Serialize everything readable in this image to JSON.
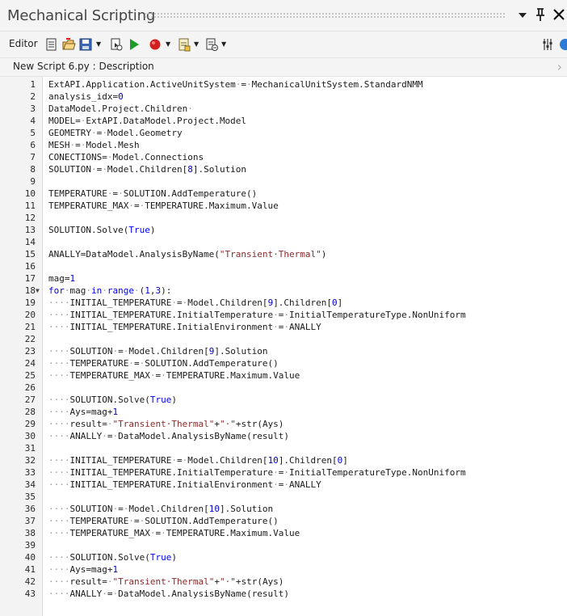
{
  "window": {
    "title": "Mechanical Scripting"
  },
  "toolbar": {
    "editor_label": "Editor"
  },
  "document": {
    "label": "New Script 6.py : Description"
  },
  "colors": {
    "background": "#ffffff",
    "gutter": "#f3f3f3",
    "keyword": "#0000ff",
    "string": "#8b2a2a",
    "run_green": "#1f9b2a",
    "record_red": "#d12020"
  },
  "icons": [
    "dropdown-arrow-icon",
    "pin-icon",
    "close-icon",
    "new-script-icon",
    "open-icon",
    "save-icon",
    "snippets-icon",
    "run-icon",
    "record-icon",
    "insert-icon",
    "breakpoint-icon",
    "settings-icon",
    "help-icon"
  ],
  "code_lines": [
    [
      [
        "t",
        "ExtAPI.Application.ActiveUnitSystem"
      ],
      [
        "w",
        "·"
      ],
      [
        "t",
        "="
      ],
      [
        "w",
        "·"
      ],
      [
        "t",
        "MechanicalUnitSystem.StandardNMM"
      ]
    ],
    [
      [
        "t",
        "analysis_idx="
      ],
      [
        "n",
        "0"
      ]
    ],
    [
      [
        "t",
        "DataModel.Project.Children"
      ],
      [
        "w",
        "·"
      ]
    ],
    [
      [
        "t",
        "MODEL="
      ],
      [
        "w",
        "·"
      ],
      [
        "t",
        "ExtAPI.DataModel.Project.Model"
      ]
    ],
    [
      [
        "t",
        "GEOMETRY"
      ],
      [
        "w",
        "·"
      ],
      [
        "t",
        "="
      ],
      [
        "w",
        "·"
      ],
      [
        "t",
        "Model.Geometry"
      ]
    ],
    [
      [
        "t",
        "MESH"
      ],
      [
        "w",
        "·"
      ],
      [
        "t",
        "="
      ],
      [
        "w",
        "·"
      ],
      [
        "t",
        "Model.Mesh"
      ]
    ],
    [
      [
        "t",
        "CONECTIONS="
      ],
      [
        "w",
        "·"
      ],
      [
        "t",
        "Model.Connections"
      ]
    ],
    [
      [
        "t",
        "SOLUTION"
      ],
      [
        "w",
        "·"
      ],
      [
        "t",
        "="
      ],
      [
        "w",
        "·"
      ],
      [
        "t",
        "Model.Children["
      ],
      [
        "n",
        "8"
      ],
      [
        "t",
        "].Solution"
      ]
    ],
    [],
    [
      [
        "t",
        "TEMPERATURE"
      ],
      [
        "w",
        "·"
      ],
      [
        "t",
        "="
      ],
      [
        "w",
        "·"
      ],
      [
        "t",
        "SOLUTION.AddTemperature()"
      ]
    ],
    [
      [
        "t",
        "TEMPERATURE_MAX"
      ],
      [
        "w",
        "·"
      ],
      [
        "t",
        "="
      ],
      [
        "w",
        "·"
      ],
      [
        "t",
        "TEMPERATURE.Maximum.Value"
      ]
    ],
    [],
    [
      [
        "t",
        "SOLUTION.Solve("
      ],
      [
        "k",
        "True"
      ],
      [
        "t",
        ")"
      ]
    ],
    [],
    [
      [
        "t",
        "ANALLY=DataModel.AnalysisByName("
      ],
      [
        "s",
        "\"Transient·Thermal\""
      ],
      [
        "t",
        ")"
      ]
    ],
    [],
    [
      [
        "t",
        "mag="
      ],
      [
        "n",
        "1"
      ]
    ],
    [
      [
        "k",
        "for"
      ],
      [
        "w",
        "·"
      ],
      [
        "t",
        "mag"
      ],
      [
        "w",
        "·"
      ],
      [
        "k",
        "in"
      ],
      [
        "w",
        "·"
      ],
      [
        "k",
        "range"
      ],
      [
        "w",
        "·"
      ],
      [
        "t",
        "("
      ],
      [
        "n",
        "1"
      ],
      [
        "t",
        ","
      ],
      [
        "n",
        "3"
      ],
      [
        "t",
        "):"
      ]
    ],
    [
      [
        "w",
        "····"
      ],
      [
        "t",
        "INITIAL_TEMPERATURE"
      ],
      [
        "w",
        "·"
      ],
      [
        "t",
        "="
      ],
      [
        "w",
        "·"
      ],
      [
        "t",
        "Model.Children["
      ],
      [
        "n",
        "9"
      ],
      [
        "t",
        "].Children["
      ],
      [
        "n",
        "0"
      ],
      [
        "t",
        "]"
      ]
    ],
    [
      [
        "w",
        "····"
      ],
      [
        "t",
        "INITIAL_TEMPERATURE.InitialTemperature"
      ],
      [
        "w",
        "·"
      ],
      [
        "t",
        "="
      ],
      [
        "w",
        "·"
      ],
      [
        "t",
        "InitialTemperatureType.NonUniform"
      ]
    ],
    [
      [
        "w",
        "····"
      ],
      [
        "t",
        "INITIAL_TEMPERATURE.InitialEnvironment"
      ],
      [
        "w",
        "·"
      ],
      [
        "t",
        "="
      ],
      [
        "w",
        "·"
      ],
      [
        "t",
        "ANALLY"
      ]
    ],
    [],
    [
      [
        "w",
        "····"
      ],
      [
        "t",
        "SOLUTION"
      ],
      [
        "w",
        "·"
      ],
      [
        "t",
        "="
      ],
      [
        "w",
        "·"
      ],
      [
        "t",
        "Model.Children["
      ],
      [
        "n",
        "9"
      ],
      [
        "t",
        "].Solution"
      ]
    ],
    [
      [
        "w",
        "····"
      ],
      [
        "t",
        "TEMPERATURE"
      ],
      [
        "w",
        "·"
      ],
      [
        "t",
        "="
      ],
      [
        "w",
        "·"
      ],
      [
        "t",
        "SOLUTION.AddTemperature()"
      ]
    ],
    [
      [
        "w",
        "····"
      ],
      [
        "t",
        "TEMPERATURE_MAX"
      ],
      [
        "w",
        "·"
      ],
      [
        "t",
        "="
      ],
      [
        "w",
        "·"
      ],
      [
        "t",
        "TEMPERATURE.Maximum.Value"
      ]
    ],
    [],
    [
      [
        "w",
        "····"
      ],
      [
        "t",
        "SOLUTION.Solve("
      ],
      [
        "k",
        "True"
      ],
      [
        "t",
        ")"
      ]
    ],
    [
      [
        "w",
        "····"
      ],
      [
        "t",
        "Ays=mag+"
      ],
      [
        "n",
        "1"
      ]
    ],
    [
      [
        "w",
        "····"
      ],
      [
        "t",
        "result="
      ],
      [
        "w",
        "·"
      ],
      [
        "s",
        "\"Transient·Thermal\""
      ],
      [
        "t",
        "+"
      ],
      [
        "s",
        "\"·\""
      ],
      [
        "t",
        "+str(Ays)"
      ]
    ],
    [
      [
        "w",
        "····"
      ],
      [
        "t",
        "ANALLY"
      ],
      [
        "w",
        "·"
      ],
      [
        "t",
        "="
      ],
      [
        "w",
        "·"
      ],
      [
        "t",
        "DataModel.AnalysisByName(result)"
      ]
    ],
    [],
    [
      [
        "w",
        "····"
      ],
      [
        "t",
        "INITIAL_TEMPERATURE"
      ],
      [
        "w",
        "·"
      ],
      [
        "t",
        "="
      ],
      [
        "w",
        "·"
      ],
      [
        "t",
        "Model.Children["
      ],
      [
        "n",
        "10"
      ],
      [
        "t",
        "].Children["
      ],
      [
        "n",
        "0"
      ],
      [
        "t",
        "]"
      ]
    ],
    [
      [
        "w",
        "····"
      ],
      [
        "t",
        "INITIAL_TEMPERATURE.InitialTemperature"
      ],
      [
        "w",
        "·"
      ],
      [
        "t",
        "="
      ],
      [
        "w",
        "·"
      ],
      [
        "t",
        "InitialTemperatureType.NonUniform"
      ]
    ],
    [
      [
        "w",
        "····"
      ],
      [
        "t",
        "INITIAL_TEMPERATURE.InitialEnvironment"
      ],
      [
        "w",
        "·"
      ],
      [
        "t",
        "="
      ],
      [
        "w",
        "·"
      ],
      [
        "t",
        "ANALLY"
      ]
    ],
    [],
    [
      [
        "w",
        "····"
      ],
      [
        "t",
        "SOLUTION"
      ],
      [
        "w",
        "·"
      ],
      [
        "t",
        "="
      ],
      [
        "w",
        "·"
      ],
      [
        "t",
        "Model.Children["
      ],
      [
        "n",
        "10"
      ],
      [
        "t",
        "].Solution"
      ]
    ],
    [
      [
        "w",
        "····"
      ],
      [
        "t",
        "TEMPERATURE"
      ],
      [
        "w",
        "·"
      ],
      [
        "t",
        "="
      ],
      [
        "w",
        "·"
      ],
      [
        "t",
        "SOLUTION.AddTemperature()"
      ]
    ],
    [
      [
        "w",
        "····"
      ],
      [
        "t",
        "TEMPERATURE_MAX"
      ],
      [
        "w",
        "·"
      ],
      [
        "t",
        "="
      ],
      [
        "w",
        "·"
      ],
      [
        "t",
        "TEMPERATURE.Maximum.Value"
      ]
    ],
    [],
    [
      [
        "w",
        "····"
      ],
      [
        "t",
        "SOLUTION.Solve("
      ],
      [
        "k",
        "True"
      ],
      [
        "t",
        ")"
      ]
    ],
    [
      [
        "w",
        "····"
      ],
      [
        "t",
        "Ays=mag+"
      ],
      [
        "n",
        "1"
      ]
    ],
    [
      [
        "w",
        "····"
      ],
      [
        "t",
        "result="
      ],
      [
        "w",
        "·"
      ],
      [
        "s",
        "\"Transient·Thermal\""
      ],
      [
        "t",
        "+"
      ],
      [
        "s",
        "\"·\""
      ],
      [
        "t",
        "+str(Ays)"
      ]
    ],
    [
      [
        "w",
        "····"
      ],
      [
        "t",
        "ANALLY"
      ],
      [
        "w",
        "·"
      ],
      [
        "t",
        "="
      ],
      [
        "w",
        "·"
      ],
      [
        "t",
        "DataModel.AnalysisByName(result)"
      ]
    ]
  ]
}
